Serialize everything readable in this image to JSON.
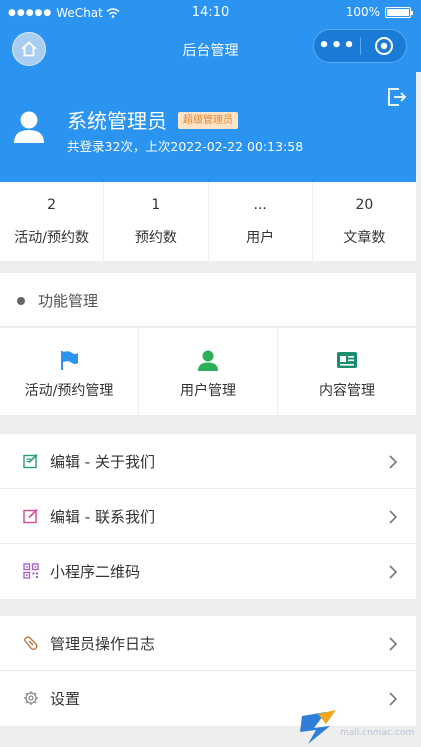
{
  "status_bar": {
    "signal_dots": "●●●●●",
    "carrier": "WeChat",
    "time": "14:10",
    "battery_percent": "100%"
  },
  "nav": {
    "title": "后台管理",
    "more_label": "•••"
  },
  "profile": {
    "name": "系统管理员",
    "role_badge": "超级管理员",
    "login_info": "共登录32次，上次2022-02-22 00:13:58"
  },
  "stats": [
    {
      "value": "2",
      "label": "活动/预约数"
    },
    {
      "value": "1",
      "label": "预约数"
    },
    {
      "value": "...",
      "label": "用户"
    },
    {
      "value": "20",
      "label": "文章数"
    }
  ],
  "function_section": {
    "title": "功能管理",
    "items": [
      {
        "label": "活动/预约管理",
        "icon": "flag-icon",
        "color": "#2b93f0"
      },
      {
        "label": "用户管理",
        "icon": "user-icon",
        "color": "#2eaf5a"
      },
      {
        "label": "内容管理",
        "icon": "id-card-icon",
        "color": "#1c8f6f"
      }
    ]
  },
  "menu_group_1": [
    {
      "label": "编辑 - 关于我们",
      "icon": "edit-icon",
      "color": "#2aa07a"
    },
    {
      "label": "编辑 - 联系我们",
      "icon": "edit-icon",
      "color": "#d64a91"
    },
    {
      "label": "小程序二维码",
      "icon": "qrcode-icon",
      "color": "#a35fc7"
    }
  ],
  "menu_group_2": [
    {
      "label": "管理员操作日志",
      "icon": "log-icon",
      "color": "#c3703a"
    },
    {
      "label": "设置",
      "icon": "gear-icon",
      "color": "#888888"
    }
  ],
  "watermark": {
    "text": "mall.cnmac.com"
  },
  "colors": {
    "primary": "#2b93f0",
    "badge_bg": "#fde3c8",
    "badge_text": "#e9842b"
  }
}
